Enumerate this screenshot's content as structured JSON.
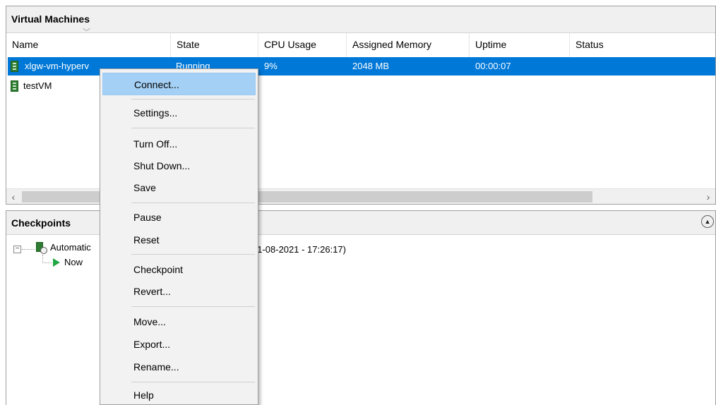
{
  "vm_panel": {
    "title": "Virtual Machines",
    "columns": [
      "Name",
      "State",
      "CPU Usage",
      "Assigned Memory",
      "Uptime",
      "Status"
    ],
    "rows": [
      {
        "name": "xlgw-vm-hyperv",
        "state": "Running",
        "cpu": "9%",
        "memory": "2048 MB",
        "uptime": "00:00:07",
        "status": "",
        "selected": true
      },
      {
        "name": "testVM",
        "state": "",
        "cpu": "",
        "memory": "",
        "uptime": "",
        "status": "",
        "selected": false
      }
    ],
    "scroll_left_icon": "‹",
    "scroll_right_icon": "›"
  },
  "checkpoints_panel": {
    "title": "Checkpoints",
    "tree": {
      "root_label": "Automatic",
      "root_date_fragment": "31-08-2021 - 17:26:17)",
      "child_label": "Now"
    },
    "collapse_icon": "chevron-up-icon"
  },
  "context_menu": {
    "items": [
      {
        "label": "Connect...",
        "highlighted": true
      },
      {
        "label": "Settings..."
      },
      {
        "label": "Turn Off..."
      },
      {
        "label": "Shut Down..."
      },
      {
        "label": "Save"
      },
      {
        "label": "Pause"
      },
      {
        "label": "Reset"
      },
      {
        "label": "Checkpoint"
      },
      {
        "label": "Revert..."
      },
      {
        "label": "Move..."
      },
      {
        "label": "Export..."
      },
      {
        "label": "Rename..."
      },
      {
        "label": "Help"
      }
    ]
  },
  "colors": {
    "selection": "#0078d7",
    "menu_highlight": "#a4d0f5",
    "vm_icon": "#2e7d32",
    "play_icon": "#22a745"
  }
}
